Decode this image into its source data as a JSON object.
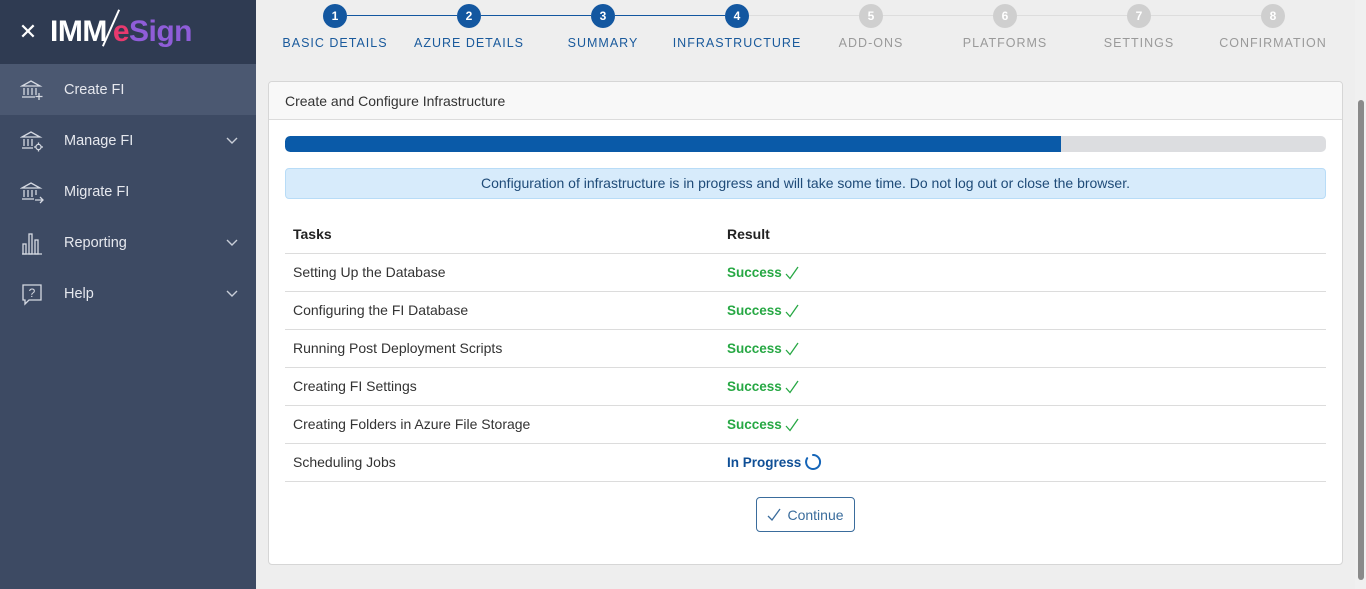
{
  "brand": {
    "imm": "IMM",
    "e": "e",
    "sign": "Sign",
    "colors": {
      "e": "#e8396e",
      "sign": "#8f5dd8"
    }
  },
  "sidebar": {
    "items": [
      {
        "label": "Create FI",
        "icon": "bank-plus-icon",
        "active": true,
        "expandable": false
      },
      {
        "label": "Manage FI",
        "icon": "bank-gear-icon",
        "active": false,
        "expandable": true
      },
      {
        "label": "Migrate FI",
        "icon": "bank-arrow-icon",
        "active": false,
        "expandable": false
      },
      {
        "label": "Reporting",
        "icon": "bar-chart-icon",
        "active": false,
        "expandable": true
      },
      {
        "label": "Help",
        "icon": "help-bubble-icon",
        "active": false,
        "expandable": true
      }
    ]
  },
  "stepper": {
    "steps": [
      {
        "num": "1",
        "label": "BASIC DETAILS",
        "state": "done"
      },
      {
        "num": "2",
        "label": "AZURE DETAILS",
        "state": "done"
      },
      {
        "num": "3",
        "label": "SUMMARY",
        "state": "done"
      },
      {
        "num": "4",
        "label": "INFRASTRUCTURE",
        "state": "done"
      },
      {
        "num": "5",
        "label": "ADD-ONS",
        "state": "todo"
      },
      {
        "num": "6",
        "label": "PLATFORMS",
        "state": "todo"
      },
      {
        "num": "7",
        "label": "SETTINGS",
        "state": "todo"
      },
      {
        "num": "8",
        "label": "CONFIRMATION",
        "state": "todo"
      }
    ],
    "colors": {
      "done": "#1357a0",
      "todo": "#cfcfcf"
    }
  },
  "card": {
    "title": "Create and Configure Infrastructure",
    "progress_fraction": 0.745,
    "alert": "Configuration of infrastructure is in progress and will take some time. Do not log out or close the browser.",
    "table": {
      "headers": [
        "Tasks",
        "Result"
      ],
      "rows": [
        {
          "task": "Setting Up the Database",
          "result": "Success",
          "status": "success"
        },
        {
          "task": "Configuring the FI Database",
          "result": "Success",
          "status": "success"
        },
        {
          "task": "Running Post Deployment Scripts",
          "result": "Success",
          "status": "success"
        },
        {
          "task": "Creating FI Settings",
          "result": "Success",
          "status": "success"
        },
        {
          "task": "Creating Folders in Azure File Storage",
          "result": "Success",
          "status": "success"
        },
        {
          "task": "Scheduling Jobs",
          "result": "In Progress",
          "status": "in-progress"
        }
      ]
    },
    "continue_label": "Continue"
  }
}
